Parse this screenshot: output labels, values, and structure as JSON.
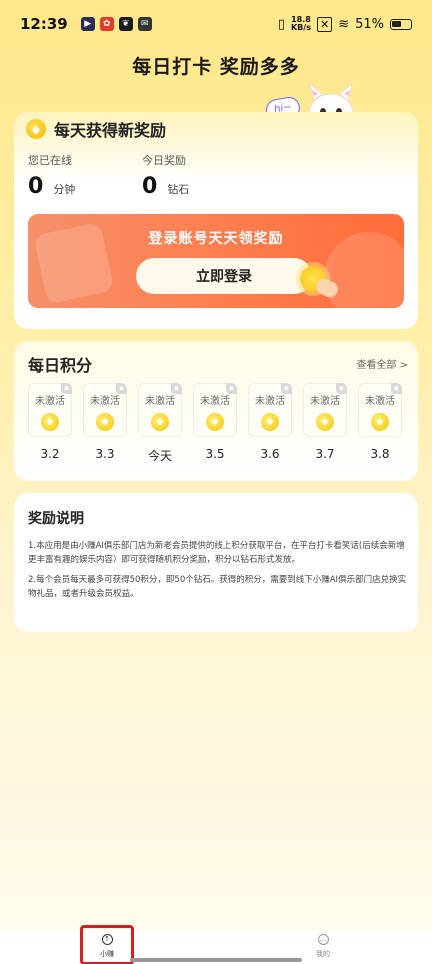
{
  "status_bar": {
    "time": "12:39",
    "net_speed_value": "18.8",
    "net_speed_unit": "KB/s",
    "battery": "51%"
  },
  "page_title": "每日打卡 奖励多多",
  "reward_card": {
    "title": "每天获得新奖励",
    "bubble": "hi~",
    "online": {
      "label": "您已在线",
      "value": "0",
      "unit": "分钟"
    },
    "today_reward": {
      "label": "今日奖励",
      "value": "0",
      "unit": "钻石"
    },
    "banner_text": "登录账号天天领奖励",
    "login_button": "立即登录"
  },
  "daily_points": {
    "title": "每日积分",
    "view_all": "查看全部 >",
    "days": [
      {
        "status": "未激活",
        "date": "3.2"
      },
      {
        "status": "未激活",
        "date": "3.3"
      },
      {
        "status": "未激活",
        "date": "今天"
      },
      {
        "status": "未激活",
        "date": "3.5"
      },
      {
        "status": "未激活",
        "date": "3.6"
      },
      {
        "status": "未激活",
        "date": "3.7"
      },
      {
        "status": "未激活",
        "date": "3.8"
      }
    ]
  },
  "explanation": {
    "title": "奖励说明",
    "para1": "1.本应用是由小赚AI俱乐部门店为新老会员提供的线上积分获取平台，在平台打卡看笑话(后续会新增更丰富有趣的娱乐内容）即可获得随机积分奖励，积分以钻石形式发放。",
    "para2": "2.每个会员每天最多可获得50积分，即50个钻石。获得的积分，需要到线下小赚AI俱乐部门店兑换实物礼品，或者升级会员权益。"
  },
  "bottom_nav": {
    "items": [
      {
        "label": "小赚",
        "icon": "upload-circle-icon",
        "active": true
      },
      {
        "label": "我的",
        "icon": "chat-dots-icon",
        "active": false
      }
    ]
  },
  "colors": {
    "banner_orange": "#FF7B4A",
    "gold": "#F2C500",
    "highlight_red": "#D81E1E"
  }
}
